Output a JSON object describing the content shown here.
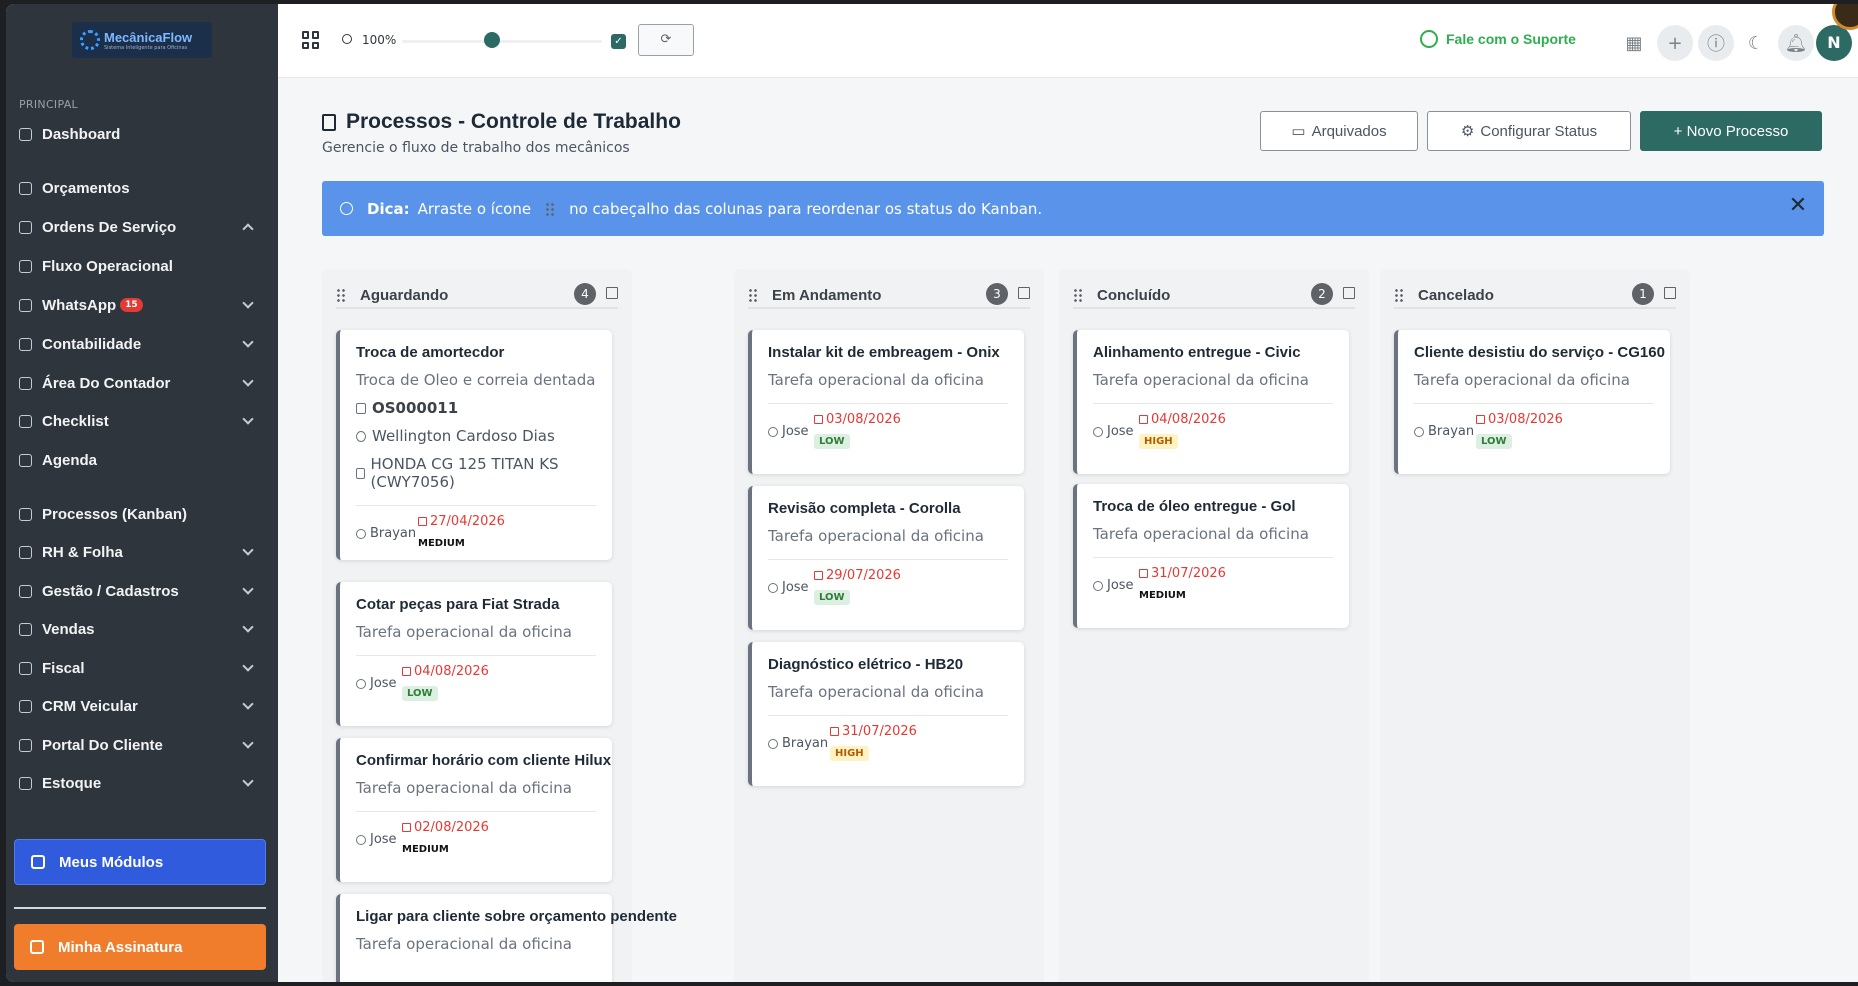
{
  "logo": {
    "name": "MecânicaFlow",
    "tagline": "Sistema Inteligente para Oficinas"
  },
  "sidebar": {
    "section_label": "PRINCIPAL",
    "items": [
      {
        "label": "Dashboard",
        "icon": "dashboard-icon"
      },
      {
        "label": "Orçamentos",
        "icon": "document-icon"
      },
      {
        "label": "Ordens De Serviço",
        "icon": "document-icon"
      },
      {
        "label": "Fluxo Operacional",
        "icon": "flow-icon"
      },
      {
        "label": "WhatsApp",
        "icon": "whatsapp-icon",
        "badge": "15"
      },
      {
        "label": "Contabilidade",
        "icon": "calculator-icon"
      },
      {
        "label": "Área Do Contador",
        "icon": "user-chart-icon"
      },
      {
        "label": "Checklist",
        "icon": "checklist-icon"
      },
      {
        "label": "Agenda",
        "icon": "calendar-icon"
      },
      {
        "label": "Processos (Kanban)",
        "icon": "clipboard-icon"
      },
      {
        "label": "RH & Folha",
        "icon": "hr-icon"
      },
      {
        "label": "Gestão / Cadastros",
        "icon": "users-icon"
      },
      {
        "label": "Vendas",
        "icon": "cart-icon"
      },
      {
        "label": "Fiscal",
        "icon": "receipt-icon"
      },
      {
        "label": "CRM Veicular",
        "icon": "chart-icon"
      },
      {
        "label": "Portal Do Cliente",
        "icon": "portal-icon"
      },
      {
        "label": "Estoque",
        "icon": "box-icon"
      }
    ],
    "modules_label": "Meus Módulos",
    "subscription_label": "Minha Assinatura"
  },
  "topbar": {
    "zoom": "100%",
    "zoom_level": 0.45,
    "support_label": "Fale com o Suporte",
    "avatar_initial": "N"
  },
  "page": {
    "title": "Processos - Controle de Trabalho",
    "subtitle": "Gerencie o fluxo de trabalho dos mecânicos",
    "archived_label": "Arquivados",
    "config_label": "Configurar Status",
    "new_label": "+ Novo Processo"
  },
  "tip": {
    "bold": "Dica:",
    "text_before": "Arraste o ícone",
    "text_after": "no cabeçalho das colunas para reordenar os status do Kanban."
  },
  "columns": [
    {
      "title": "Aguardando",
      "count": "4",
      "cards": [
        {
          "title": "Troca de amortecdor",
          "desc": "Troca de Oleo e correia dentada",
          "os": "OS000011",
          "client": "Wellington Cardoso Dias",
          "vehicle": "HONDA CG 125 TITAN KS (CWY7056)",
          "assignee": "Brayan",
          "date": "27/04/2026",
          "priority": "MEDIUM"
        },
        {
          "title": "Cotar peças para Fiat Strada",
          "desc": "Tarefa operacional da oficina",
          "assignee": "Jose",
          "date": "04/08/2026",
          "priority": "LOW"
        },
        {
          "title": "Confirmar horário com cliente Hilux",
          "desc": "Tarefa operacional da oficina",
          "assignee": "Jose",
          "date": "02/08/2026",
          "priority": "MEDIUM"
        },
        {
          "title": "Ligar para cliente sobre orçamento pendente",
          "desc": "Tarefa operacional da oficina"
        }
      ]
    },
    {
      "title": "Em Andamento",
      "count": "3",
      "cards": [
        {
          "title": "Instalar kit de embreagem - Onix",
          "desc": "Tarefa operacional da oficina",
          "assignee": "Jose",
          "date": "03/08/2026",
          "priority": "LOW"
        },
        {
          "title": "Revisão completa - Corolla",
          "desc": "Tarefa operacional da oficina",
          "assignee": "Jose",
          "date": "29/07/2026",
          "priority": "LOW"
        },
        {
          "title": "Diagnóstico elétrico - HB20",
          "desc": "Tarefa operacional da oficina",
          "assignee": "Brayan",
          "date": "31/07/2026",
          "priority": "HIGH"
        }
      ]
    },
    {
      "title": "Concluído",
      "count": "2",
      "cards": [
        {
          "title": "Alinhamento entregue - Civic",
          "desc": "Tarefa operacional da oficina",
          "assignee": "Jose",
          "date": "04/08/2026",
          "priority": "HIGH"
        },
        {
          "title": "Troca de óleo entregue - Gol",
          "desc": "Tarefa operacional da oficina",
          "assignee": "Jose",
          "date": "31/07/2026",
          "priority": "MEDIUM"
        }
      ]
    },
    {
      "title": "Cancelado",
      "count": "1",
      "cards": [
        {
          "title": "Cliente desistiu do serviço - CG160",
          "desc": "Tarefa operacional da oficina",
          "assignee": "Brayan",
          "date": "03/08/2026",
          "priority": "LOW"
        }
      ]
    }
  ]
}
